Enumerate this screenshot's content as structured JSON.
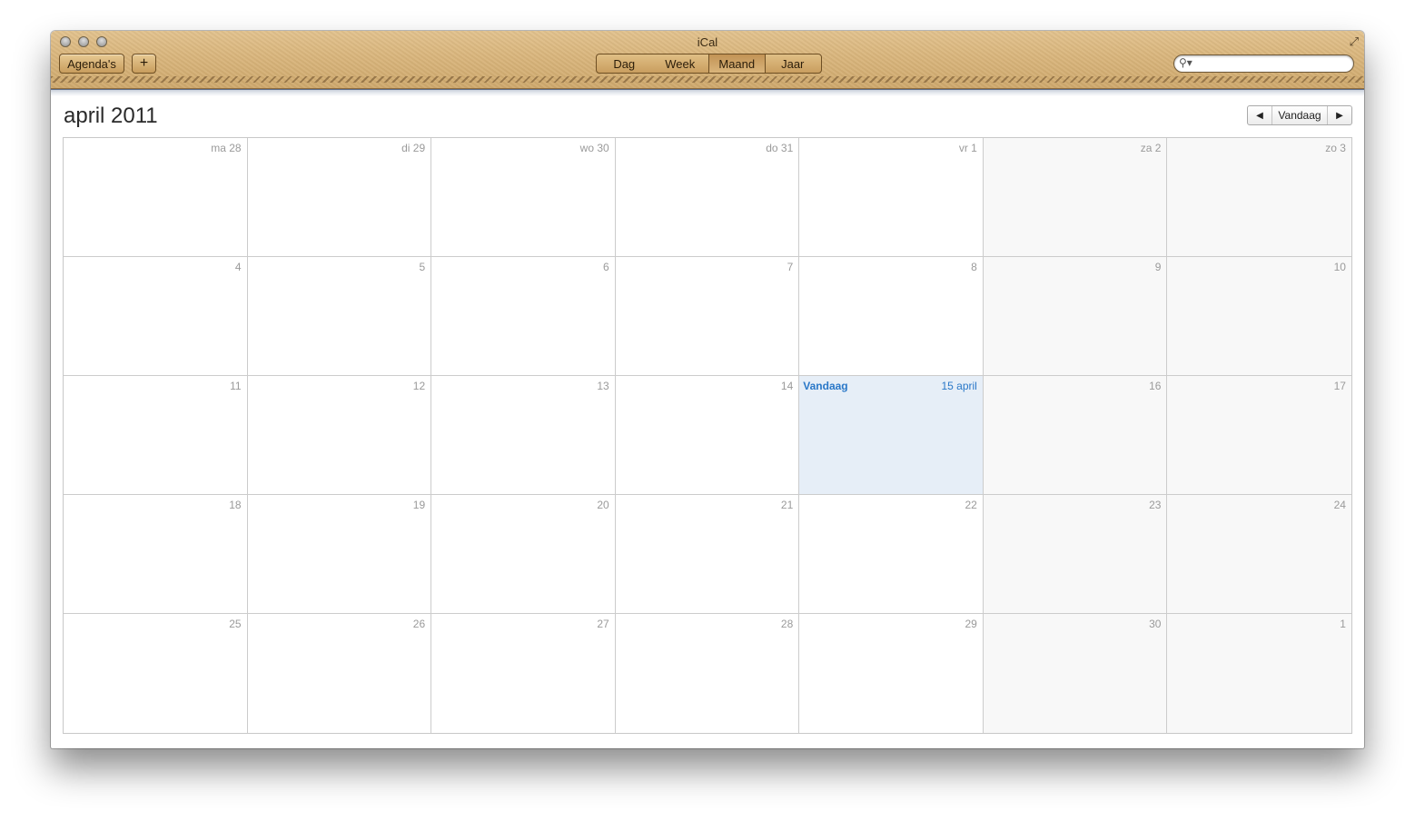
{
  "window": {
    "title": "iCal"
  },
  "toolbar": {
    "calendars_label": "Agenda's",
    "add_label": "+",
    "views": [
      {
        "label": "Dag",
        "active": false
      },
      {
        "label": "Week",
        "active": false
      },
      {
        "label": "Maand",
        "active": true
      },
      {
        "label": "Jaar",
        "active": false
      }
    ],
    "search_placeholder": ""
  },
  "header": {
    "month_title": "april 2011",
    "today_button": "Vandaag"
  },
  "colors": {
    "accent": "#2a78c8",
    "toolbar_leather": "#d9b57c",
    "today_bg": "#e6eef7",
    "weekend_bg": "#f8f8f8"
  },
  "weeks": [
    [
      {
        "label": "ma 28",
        "weekend": false
      },
      {
        "label": "di 29",
        "weekend": false
      },
      {
        "label": "wo 30",
        "weekend": false
      },
      {
        "label": "do 31",
        "weekend": false
      },
      {
        "label": "vr 1",
        "weekend": false
      },
      {
        "label": "za 2",
        "weekend": true
      },
      {
        "label": "zo 3",
        "weekend": true
      }
    ],
    [
      {
        "label": "4",
        "weekend": false
      },
      {
        "label": "5",
        "weekend": false
      },
      {
        "label": "6",
        "weekend": false
      },
      {
        "label": "7",
        "weekend": false
      },
      {
        "label": "8",
        "weekend": false
      },
      {
        "label": "9",
        "weekend": true
      },
      {
        "label": "10",
        "weekend": true
      }
    ],
    [
      {
        "label": "11",
        "weekend": false
      },
      {
        "label": "12",
        "weekend": false
      },
      {
        "label": "13",
        "weekend": false
      },
      {
        "label": "14",
        "weekend": false
      },
      {
        "label": "15 april",
        "weekend": false,
        "today": true,
        "today_label": "Vandaag"
      },
      {
        "label": "16",
        "weekend": true
      },
      {
        "label": "17",
        "weekend": true
      }
    ],
    [
      {
        "label": "18",
        "weekend": false
      },
      {
        "label": "19",
        "weekend": false
      },
      {
        "label": "20",
        "weekend": false
      },
      {
        "label": "21",
        "weekend": false
      },
      {
        "label": "22",
        "weekend": false
      },
      {
        "label": "23",
        "weekend": true
      },
      {
        "label": "24",
        "weekend": true
      }
    ],
    [
      {
        "label": "25",
        "weekend": false
      },
      {
        "label": "26",
        "weekend": false
      },
      {
        "label": "27",
        "weekend": false
      },
      {
        "label": "28",
        "weekend": false
      },
      {
        "label": "29",
        "weekend": false
      },
      {
        "label": "30",
        "weekend": true
      },
      {
        "label": "1",
        "weekend": true
      }
    ]
  ]
}
